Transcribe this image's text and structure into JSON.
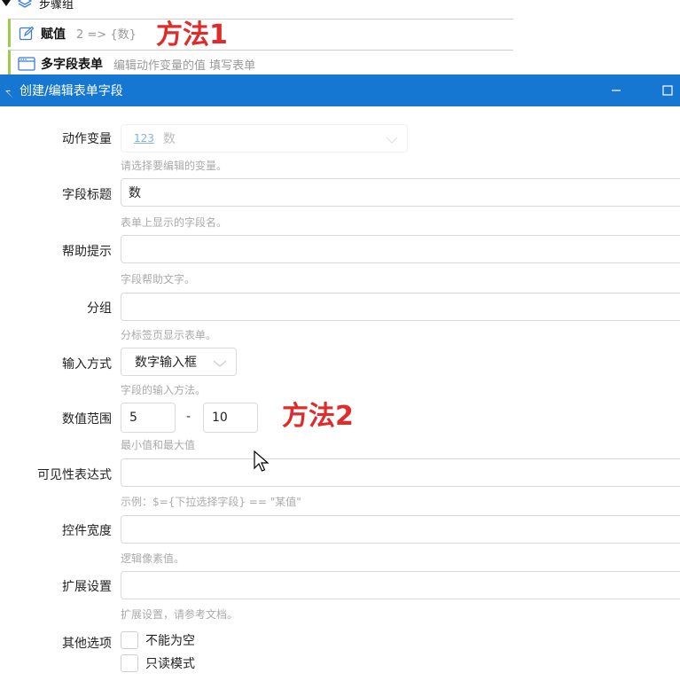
{
  "steps": {
    "group_label": "步骤组",
    "rows": [
      {
        "title": "赋值",
        "desc": "2 => {数}"
      },
      {
        "title": "多字段表单",
        "desc": "编辑动作变量的值 填写表单"
      }
    ]
  },
  "annotations": {
    "method1": "方法1",
    "method2": "方法2"
  },
  "dialog": {
    "title": "创建/编辑表单字段",
    "fields": {
      "action_var": {
        "label": "动作变量",
        "value": "数",
        "icon_text": "123",
        "help": "请选择要编辑的变量。"
      },
      "field_title": {
        "label": "字段标题",
        "value": "数",
        "help": "表单上显示的字段名。"
      },
      "help_tip": {
        "label": "帮助提示",
        "value": "",
        "help": "字段帮助文字。"
      },
      "group": {
        "label": "分组",
        "value": "",
        "help": "分标签页显示表单。"
      },
      "input_mode": {
        "label": "输入方式",
        "value": "数字输入框",
        "help": "字段的输入方法。"
      },
      "range": {
        "label": "数值范围",
        "min": "5",
        "sep": "-",
        "max": "10",
        "help": "最小值和最大值"
      },
      "visible_expr": {
        "label": "可见性表达式",
        "value": "",
        "help": "示例：$={下拉选择字段} == \"某值\""
      },
      "width": {
        "label": "控件宽度",
        "value": "",
        "help": "逻辑像素值。"
      },
      "ext": {
        "label": "扩展设置",
        "value": "",
        "help": "扩展设置，请参考文档。"
      },
      "other": {
        "label": "其他选项",
        "options": [
          "不能为空",
          "只读模式"
        ]
      }
    }
  },
  "colors": {
    "titlebar": "#1677d3",
    "annotation": "#e02b2b",
    "step_accent": "#9ccc4a"
  }
}
